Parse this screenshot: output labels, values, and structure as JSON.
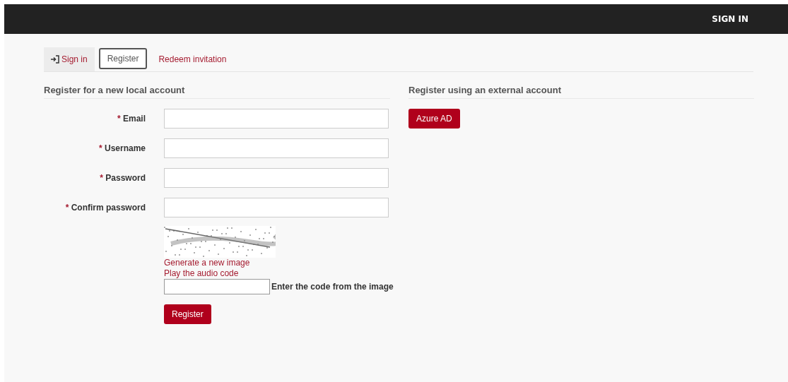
{
  "navbar": {
    "link": "SIGN IN"
  },
  "tabs": [
    {
      "label": "Sign in",
      "selected": false,
      "shaded": true,
      "kind": "icon"
    },
    {
      "label": "Register",
      "selected": true,
      "shaded": false
    },
    {
      "label": "Redeem invitation",
      "selected": false,
      "shaded": false
    }
  ],
  "local_account": {
    "heading": "Register for a new local account",
    "fields": [
      {
        "label": "Email",
        "required_mark": "*"
      },
      {
        "label": "Username",
        "required_mark": "*"
      },
      {
        "label": "Password",
        "required_mark": "*"
      },
      {
        "label": "Confirm password",
        "required_mark": "*"
      }
    ],
    "captcha": {
      "links": [
        "Generate a new image",
        "Play the audio code"
      ],
      "code_label": "Enter the code from the image"
    },
    "submit": "Register"
  },
  "external_account": {
    "heading": "Register using an external account",
    "providers": [
      "Azure AD"
    ]
  }
}
